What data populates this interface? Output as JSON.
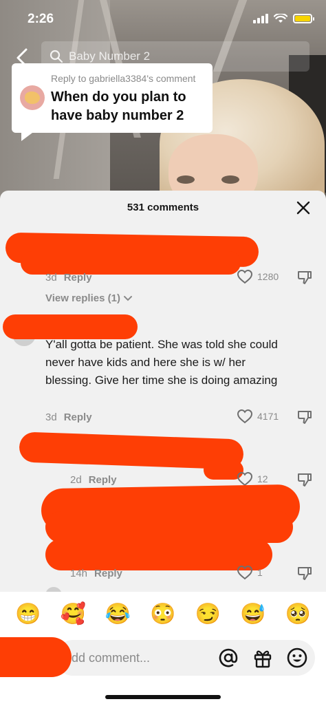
{
  "status_bar": {
    "time": "2:26",
    "battery_color": "#f7d400"
  },
  "search": {
    "query": "Baby Number 2"
  },
  "reply_context": {
    "meta": "Reply to gabriella3384's comment",
    "title": "When do you plan to have baby number 2"
  },
  "comments_panel": {
    "title": "531 comments",
    "comments": [
      {
        "time": "3d",
        "reply_label": "Reply",
        "likes": "1280",
        "view_replies": "View replies (1)"
      },
      {
        "text": "Y'all gotta be patient. She was told she could never have kids and here she is w/ her blessing. Give her time she is doing amazing",
        "time": "3d",
        "reply_label": "Reply",
        "likes": "4171"
      },
      {
        "time": "2d",
        "reply_label": "Reply",
        "likes": "12"
      },
      {
        "time": "14h",
        "reply_label": "Reply",
        "likes": "1"
      }
    ]
  },
  "emoji_bar": {
    "emojis": [
      "😁",
      "🥰",
      "😂",
      "😳",
      "😏",
      "😅",
      "🥺"
    ]
  },
  "input": {
    "placeholder": "dd comment..."
  },
  "colors": {
    "redaction": "#fe3e05",
    "panel_bg": "#f1f1f1",
    "muted_text": "#8a8a8a"
  }
}
